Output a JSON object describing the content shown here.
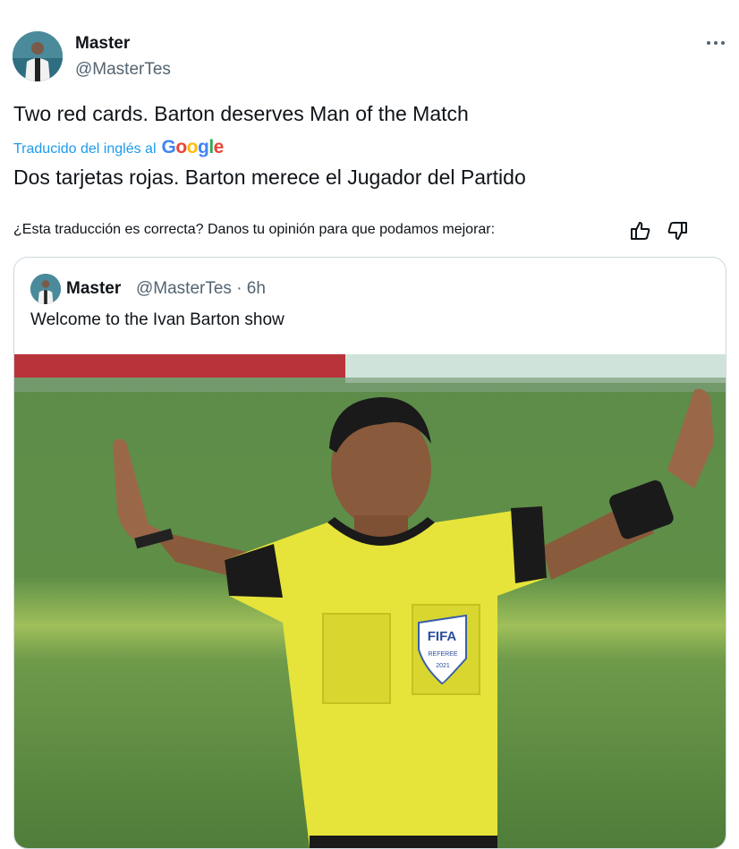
{
  "tweet": {
    "author_name": "Master",
    "author_handle": "@MasterTes",
    "more_icon": "more-horizontal-icon",
    "text": "Two red cards. Barton deserves Man of the Match",
    "translated_label": "Traducido del inglés al",
    "translation_provider": "Google",
    "translation": "Dos tarjetas rojas. Barton merece el Jugador del Partido",
    "feedback_prompt": "¿Esta traducción es correcta? Danos tu opinión para que podamos mejorar:",
    "feedback_icons": [
      "thumbs-up-icon",
      "thumbs-down-icon"
    ]
  },
  "quoted": {
    "author_name": "Master",
    "meta": "@MasterTes · 6h",
    "text": "Welcome to the Ivan Barton show",
    "photo_badge": "FIFA",
    "photo_badge_sub": "REFEREE",
    "photo_badge_year": "2021"
  },
  "colors": {
    "link": "#1d9bf0",
    "secondary_text": "#536471",
    "border": "#cfd9de",
    "jersey": "#e6e43a"
  }
}
